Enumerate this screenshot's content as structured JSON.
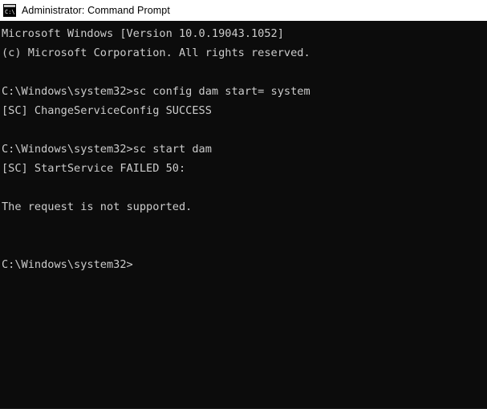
{
  "window": {
    "title": "Administrator: Command Prompt",
    "icon": "command-prompt-icon",
    "icon_label": "C:\\",
    "background_color": "#0c0c0c",
    "titlebar_color": "#ffffff",
    "text_color": "#cccccc"
  },
  "terminal": {
    "lines": [
      "Microsoft Windows [Version 10.0.19043.1052]",
      "(c) Microsoft Corporation. All rights reserved.",
      "",
      "C:\\Windows\\system32>sc config dam start= system",
      "[SC] ChangeServiceConfig SUCCESS",
      "",
      "C:\\Windows\\system32>sc start dam",
      "[SC] StartService FAILED 50:",
      "",
      "The request is not supported.",
      "",
      "",
      "C:\\Windows\\system32>"
    ]
  }
}
